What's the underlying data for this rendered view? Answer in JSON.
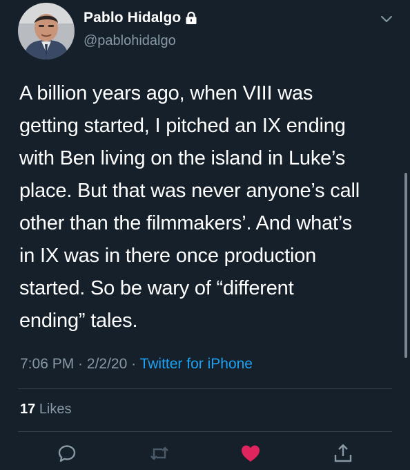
{
  "author": {
    "name": "Pablo Hidalgo",
    "handle": "@pablohidalgo",
    "protected": true
  },
  "tweet": {
    "text": "A billion years ago, when VIII was\ngetting started, I pitched an IX ending\nwith Ben living on the island in Luke’s\nplace. But that was never anyone’s call\nother than the filmmakers’. And what’s\nin IX was in there once production\nstarted. So be wary of “different\nending” tales.",
    "time": "7:06 PM",
    "date": "2/2/20",
    "separator": " · ",
    "source": "Twitter for iPhone"
  },
  "stats": {
    "likes_count": "17",
    "likes_label": "Likes"
  },
  "actions": [
    {
      "name": "reply",
      "icon": "reply-icon"
    },
    {
      "name": "retweet",
      "icon": "retweet-icon"
    },
    {
      "name": "like",
      "icon": "heart-icon",
      "active": true
    },
    {
      "name": "share",
      "icon": "share-icon"
    }
  ],
  "colors": {
    "background": "#15202b",
    "secondary_text": "#8899a6",
    "link": "#1da1f2",
    "like_active": "#e0245e",
    "divider": "#38444d"
  }
}
